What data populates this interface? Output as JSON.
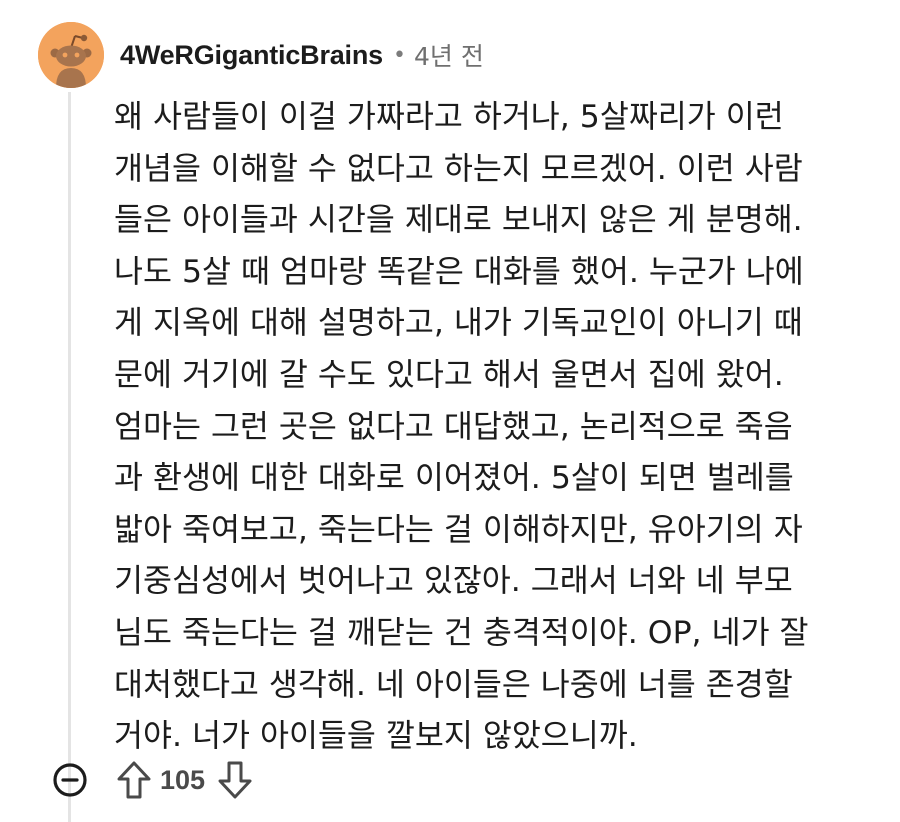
{
  "comment": {
    "author": "4WeRGiganticBrains",
    "separator": "•",
    "time": "4년 전",
    "body_lines": [
      "왜 사람들이 이걸 가짜라고 하거나, 5살짜리가 이런",
      "개념을 이해할 수 없다고 하는지 모르겠어. 이런 사람",
      "들은 아이들과 시간을 제대로 보내지 않은 게 분명해.",
      "나도 5살 때 엄마랑 똑같은 대화를 했어. 누군가 나에",
      "게 지옥에 대해 설명하고, 내가 기독교인이 아니기 때",
      "문에 거기에 갈 수도 있다고 해서 울면서 집에 왔어.",
      "엄마는 그런 곳은 없다고 대답했고, 논리적으로 죽음",
      "과 환생에 대한 대화로 이어졌어. 5살이 되면 벌레를",
      "밟아 죽여보고, 죽는다는 걸 이해하지만, 유아기의 자",
      "기중심성에서 벗어나고 있잖아. 그래서 너와 네 부모",
      "님도 죽는다는 걸 깨닫는 건 충격적이야. OP, 네가 잘",
      "대처했다고 생각해. 네 아이들은 나중에 너를 존경할",
      "거야. 너가 아이들을 깔보지 않았으니까."
    ],
    "score": "105"
  },
  "icons": {
    "avatar": "snoo-avatar-icon",
    "collapse": "minus-circle-icon",
    "upvote": "arrow-up-outline-icon",
    "downvote": "arrow-down-outline-icon"
  },
  "colors": {
    "avatar_bg": "#f3a35d",
    "text": "#1c1c1c",
    "meta": "#6f6f6f",
    "thread_line": "#e4e4e4"
  }
}
